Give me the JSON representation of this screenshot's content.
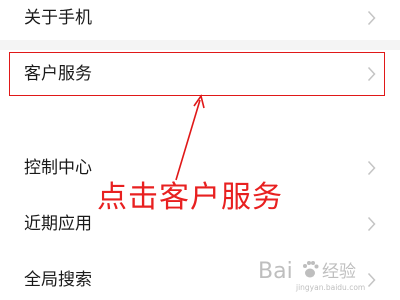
{
  "settings": {
    "items": [
      {
        "label": "关于手机",
        "icon": "chevron-right-icon"
      },
      {
        "label": "客户服务",
        "icon": "chevron-right-icon"
      },
      {
        "label": "控制中心",
        "icon": "chevron-right-icon"
      },
      {
        "label": "近期应用",
        "icon": "chevron-right-icon"
      },
      {
        "label": "全局搜索",
        "icon": "chevron-right-icon"
      }
    ]
  },
  "annotation": {
    "text": "点击客户服务",
    "color": "#e82020"
  },
  "watermark": {
    "brand": "Bai",
    "brand_icon": "paw-icon",
    "suffix": "经验",
    "url": "jingyan.baidu.com"
  },
  "colors": {
    "background": "#ffffff",
    "chevron": "#c4c4c4",
    "highlight": "#e01818"
  }
}
